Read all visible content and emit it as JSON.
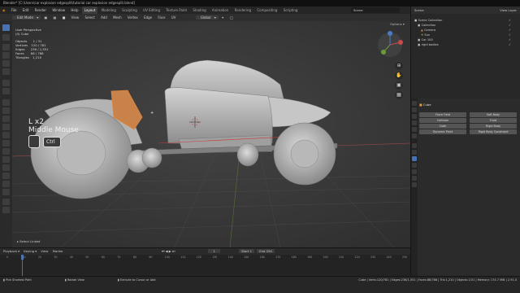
{
  "window": {
    "title": "Blender* [C:\\Users\\car explosion edgesplit\\tutorial car explosion edgesplit.blend]"
  },
  "menu": [
    "File",
    "Edit",
    "Render",
    "Window",
    "Help"
  ],
  "workspaces": [
    "Layout",
    "Modeling",
    "Sculpting",
    "UV Editing",
    "Texture Paint",
    "Shading",
    "Animation",
    "Rendering",
    "Compositing",
    "Scripting"
  ],
  "active_workspace": "Layout",
  "scene": {
    "label": "Scene",
    "view_layer": "View Layer"
  },
  "viewport": {
    "mode": "Edit Mode",
    "menus": [
      "View",
      "Select",
      "Add",
      "Mesh",
      "Vertex",
      "Edge",
      "Face",
      "UV"
    ],
    "orientation": "Global",
    "options": "Options",
    "view_name": "User Perspective",
    "object_name": "(0) Cube",
    "stats": [
      {
        "label": "Objects",
        "value": "1 / 31"
      },
      {
        "label": "Vertices",
        "value": "120 / 781"
      },
      {
        "label": "Edges",
        "value": "236 / 1,551"
      },
      {
        "label": "Faces",
        "value": "88 / 788"
      },
      {
        "label": "Triangles",
        "value": "1,210"
      }
    ],
    "key_hint": {
      "line1": "L x2",
      "line2": "Middle Mouse",
      "modifier": "Ctrl"
    },
    "status_op": "Select Linked"
  },
  "outliner": {
    "rows": [
      {
        "label": "Scene Collection",
        "indent": 0
      },
      {
        "label": "Collection",
        "indent": 1
      },
      {
        "label": "Camera",
        "indent": 2
      },
      {
        "label": "Sun",
        "indent": 2
      },
      {
        "label": "Car 100",
        "indent": 1
      },
      {
        "label": "rigid bodies",
        "indent": 1
      }
    ]
  },
  "properties": {
    "object": "Cube",
    "buttons": [
      [
        "Force Field",
        "Soft Body"
      ],
      [
        "Collision",
        "Fluid"
      ],
      [
        "Cloth",
        "Rigid Body"
      ],
      [
        "Dynamic Paint",
        "Rigid Body Constraint"
      ]
    ]
  },
  "timeline": {
    "menus": [
      "Playback",
      "Keying",
      "View",
      "Marker"
    ],
    "current_frame": "1",
    "start_label": "Start",
    "start": "1",
    "end_label": "End",
    "end": "250",
    "ticks": [
      "0",
      "10",
      "20",
      "30",
      "40",
      "50",
      "60",
      "70",
      "80",
      "90",
      "100",
      "110",
      "120",
      "130",
      "140",
      "150",
      "160",
      "170",
      "180",
      "190",
      "200",
      "210",
      "220",
      "230",
      "240",
      "250"
    ]
  },
  "statusbar": {
    "left": "Pick Shortest Path",
    "middle": "Rotate View",
    "right_hint": "Extrude to Cursor or Add",
    "info": "Cube | Verts:120/781 | Edges:236/1,551 | Faces:88/788 | Tris:1,210 | Objects:1/31 | Memory: 174.7 MiB | 2.91.0"
  },
  "colors": {
    "accent": "#4772b3",
    "selection": "#e0873a",
    "mesh": "#bdbdbd",
    "viewport_bg": "#3b3b3b"
  }
}
